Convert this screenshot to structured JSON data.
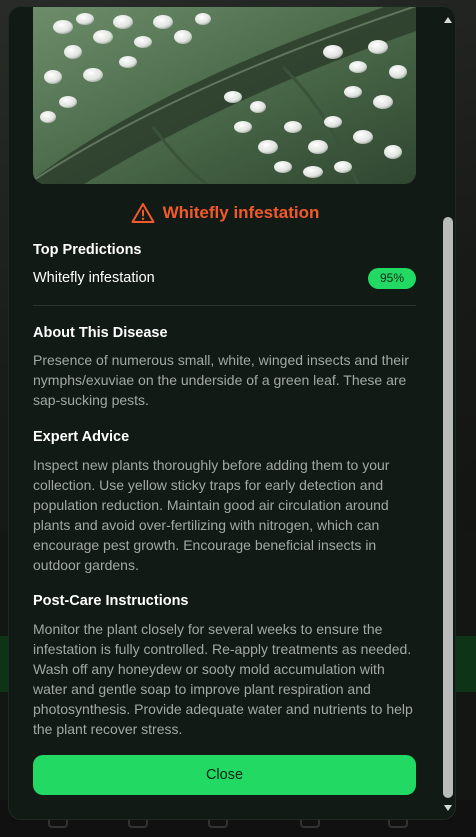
{
  "result": {
    "title": "Whitefly infestation",
    "title_color": "#f2592b",
    "icon": "warning-triangle-icon"
  },
  "predictions": {
    "heading": "Top Predictions",
    "items": [
      {
        "label": "Whitefly infestation",
        "confidence": "95%",
        "confidence_fraction": 0.95
      }
    ]
  },
  "about": {
    "heading": "About This Disease",
    "text": "Presence of numerous small, white, winged insects and their nymphs/exuviae on the underside of a green leaf. These are sap-sucking pests."
  },
  "advice": {
    "heading": "Expert Advice",
    "text": "Inspect new plants thoroughly before adding them to your collection. Use yellow sticky traps for early detection and population reduction. Maintain good air circulation around plants and avoid over-fertilizing with nitrogen, which can encourage pest growth. Encourage beneficial insects in outdoor gardens."
  },
  "post_care": {
    "heading": "Post-Care Instructions",
    "text": "Monitor the plant closely for several weeks to ensure the infestation is fully controlled. Re-apply treatments as needed. Wash off any honeydew or sooty mold accumulation with water and gentle soap to improve plant respiration and photosynthesis. Provide adequate water and nutrients to help the plant recover stress."
  },
  "actions": {
    "close_label": "Close"
  },
  "colors": {
    "accent": "#22d964",
    "modal_bg": "#121a16",
    "warning": "#f2592b"
  }
}
